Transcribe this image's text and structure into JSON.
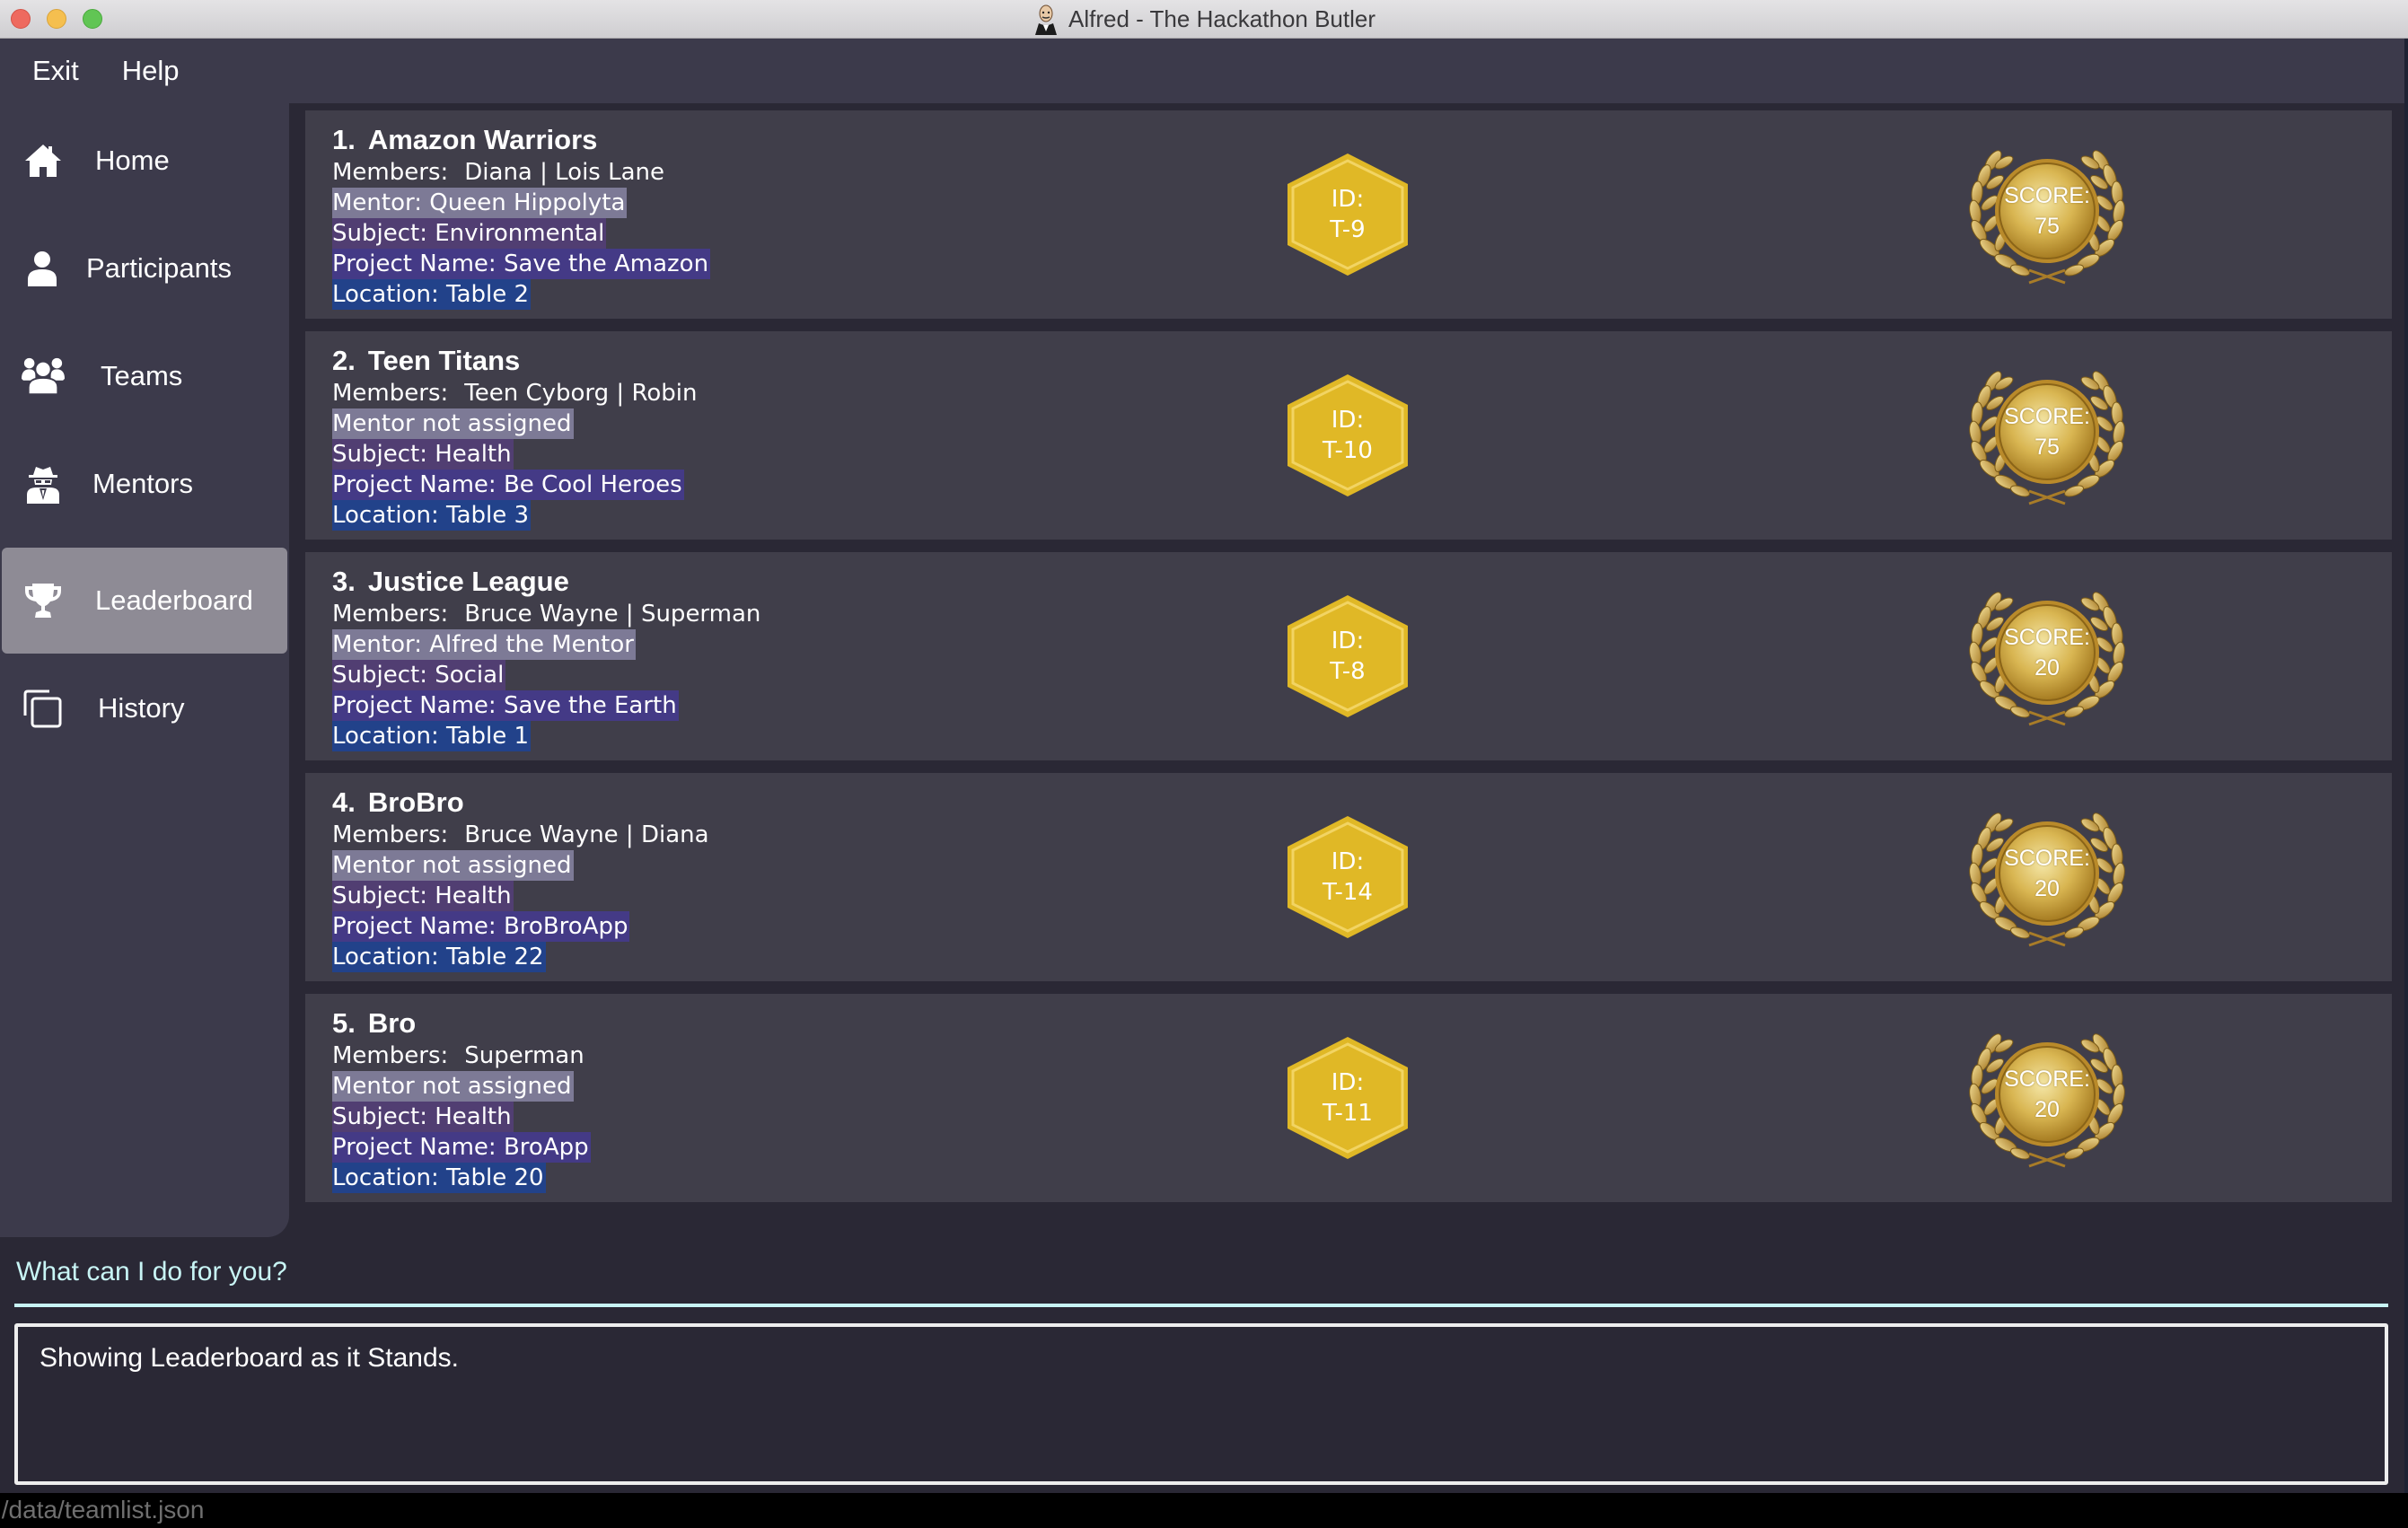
{
  "window": {
    "title": "Alfred - The Hackathon Butler"
  },
  "menu": {
    "items": [
      "Exit",
      "Help"
    ]
  },
  "sidebar": {
    "items": [
      {
        "label": "Home",
        "icon": "home-icon",
        "active": false
      },
      {
        "label": "Participants",
        "icon": "user-icon",
        "active": false
      },
      {
        "label": "Teams",
        "icon": "group-icon",
        "active": false
      },
      {
        "label": "Mentors",
        "icon": "spy-icon",
        "active": false
      },
      {
        "label": "Leaderboard",
        "icon": "trophy-icon",
        "active": true
      },
      {
        "label": "History",
        "icon": "copy-icon",
        "active": false
      }
    ]
  },
  "leaderboard": {
    "teams": [
      {
        "rank": "1.",
        "name": "Amazon Warriors",
        "members_label": "Members:",
        "members": "Diana | Lois Lane",
        "mentor": "Mentor: Queen Hippolyta",
        "subject": "Subject: Environmental",
        "project": "Project Name: Save the Amazon",
        "location": "Location:  Table 2",
        "id_label": "ID:",
        "id": "T-9",
        "score_label": "SCORE:",
        "score": "75"
      },
      {
        "rank": "2.",
        "name": "Teen Titans",
        "members_label": "Members:",
        "members": "Teen Cyborg | Robin",
        "mentor": "Mentor not assigned",
        "subject": "Subject: Health",
        "project": "Project Name: Be Cool Heroes",
        "location": "Location:  Table 3",
        "id_label": "ID:",
        "id": "T-10",
        "score_label": "SCORE:",
        "score": "75"
      },
      {
        "rank": "3.",
        "name": "Justice League",
        "members_label": "Members:",
        "members": "Bruce Wayne | Superman",
        "mentor": "Mentor: Alfred the Mentor",
        "subject": "Subject: Social",
        "project": "Project Name: Save the Earth",
        "location": "Location:  Table 1",
        "id_label": "ID:",
        "id": "T-8",
        "score_label": "SCORE:",
        "score": "20"
      },
      {
        "rank": "4.",
        "name": "BroBro",
        "members_label": "Members:",
        "members": "Bruce Wayne | Diana",
        "mentor": "Mentor not assigned",
        "subject": "Subject: Health",
        "project": "Project Name: BroBroApp",
        "location": "Location:  Table 22",
        "id_label": "ID:",
        "id": "T-14",
        "score_label": "SCORE:",
        "score": "20"
      },
      {
        "rank": "5.",
        "name": "Bro",
        "members_label": "Members:",
        "members": "Superman",
        "mentor": "Mentor not assigned",
        "subject": "Subject: Health",
        "project": "Project Name: BroApp",
        "location": "Location:  Table 20",
        "id_label": "ID:",
        "id": "T-11",
        "score_label": "SCORE:",
        "score": "20"
      }
    ]
  },
  "command": {
    "placeholder": "What can I do for you?",
    "value": ""
  },
  "result": {
    "text": "Showing Leaderboard as it Stands."
  },
  "status": {
    "path": "./data/teamlist.json"
  },
  "colors": {
    "background": "#2a2835",
    "panel": "#3c3a4b",
    "card": "#403e4a",
    "active_nav": "#8e8b95",
    "mentor_tag": "#7d7a96",
    "subject_tag": "#513e72",
    "project_tag": "#443a86",
    "location_tag": "#22428a",
    "id_badge": "#e0b826",
    "prompt_accent": "#c8f5f5"
  }
}
